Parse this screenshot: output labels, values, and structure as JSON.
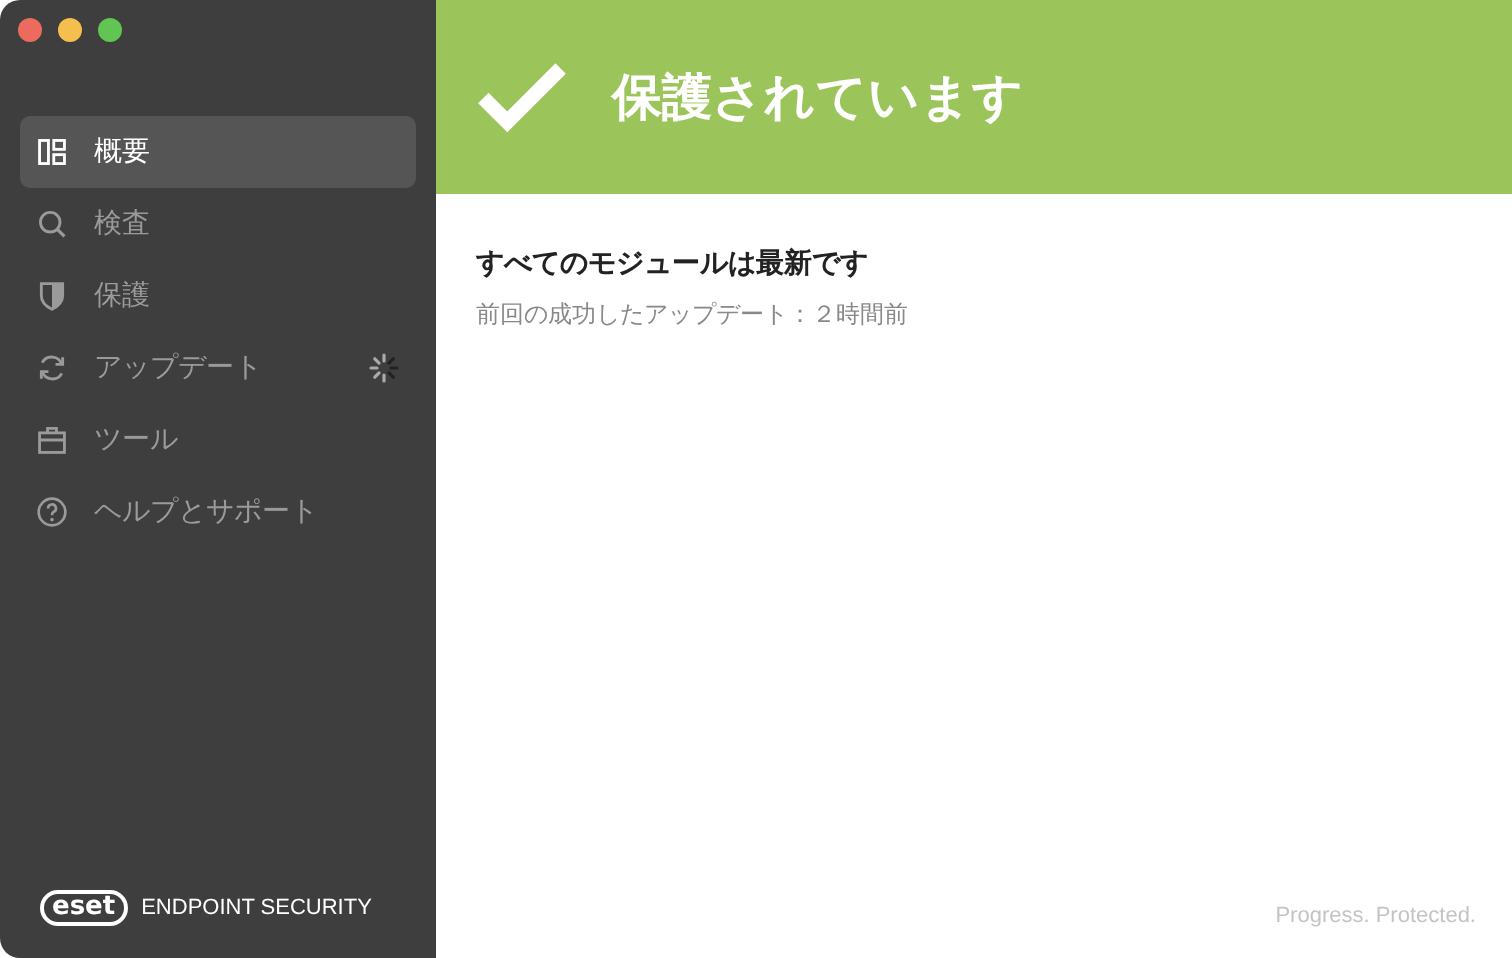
{
  "window": {
    "controls": [
      {
        "color": "#ed6a5e"
      },
      {
        "color": "#f5bf4f"
      },
      {
        "color": "#61c554"
      }
    ]
  },
  "sidebar": {
    "items": [
      {
        "kind": "overview",
        "label": "概要",
        "selected": true,
        "busy": false
      },
      {
        "kind": "scan",
        "label": "検査",
        "selected": false,
        "busy": false
      },
      {
        "kind": "protection",
        "label": "保護",
        "selected": false,
        "busy": false
      },
      {
        "kind": "update",
        "label": "アップデート",
        "selected": false,
        "busy": true
      },
      {
        "kind": "tools",
        "label": "ツール",
        "selected": false,
        "busy": false
      },
      {
        "kind": "help",
        "label": "ヘルプとサポート",
        "selected": false,
        "busy": false
      }
    ],
    "logo": "eset",
    "product": "ENDPOINT SECURITY"
  },
  "status": {
    "title": "保護されています"
  },
  "content": {
    "heading": "すべてのモジュールは最新です",
    "detail": "前回の成功したアップデート：２時間前"
  },
  "footer": {
    "tagline": "Progress. Protected."
  }
}
